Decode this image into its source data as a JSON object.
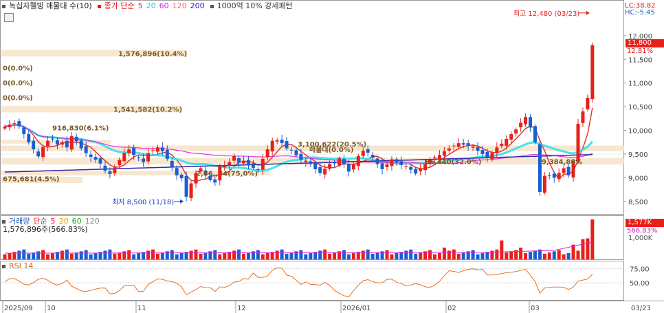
{
  "header": {
    "indicator_label": "녹십자웰빙 매물대 수(10)",
    "ma_label": "종가 단순",
    "ma_periods": [
      "5",
      "20",
      "60",
      "120",
      "200"
    ],
    "ma_colors": [
      "#e02020",
      "#20c8e0",
      "#e020e0",
      "#ff6060",
      "#2020c0"
    ],
    "extra_label": "1000억 10% 강세패턴"
  },
  "price_right": {
    "lc": "LC:38.82",
    "hc": "HC:-5.45",
    "current": "11,800",
    "current_pct": "12.81%"
  },
  "volume_header": {
    "label": "거래량",
    "ma_label": "단순",
    "periods": [
      "5",
      "20",
      "60",
      "120"
    ],
    "period_colors": [
      "#e0a000",
      "#e0a000",
      "#20a020",
      "#888888"
    ],
    "summary": "1,576,896주(566.83%)"
  },
  "volume_right": {
    "value": "1,577K",
    "pct": "566.83%",
    "tick": "1,000K"
  },
  "rsi_header": {
    "label": "RSI 14"
  },
  "chart_data": {
    "type": "candlestick",
    "y_ticks": [
      "12,000",
      "11,500",
      "11,000",
      "10,500",
      "10,000",
      "9,500",
      "9,000",
      "8,500"
    ],
    "y_tick_values": [
      12000,
      11500,
      11000,
      10500,
      10000,
      9500,
      9000,
      8500
    ],
    "ylim": [
      8250,
      12550
    ],
    "x_ticks": [
      "2025/09",
      "10",
      "11",
      "12",
      "2026/01",
      "02",
      "03",
      "03/23"
    ],
    "high_annotation": "최고 12,480 (03/23)",
    "low_annotation": "최저 8,500 (11/18)",
    "volume_profile_labels": [
      "1,576,896(10.4%)",
      "0(0.0%)",
      "0(0.0%)",
      "0(0.0%)",
      "1,541,582(10.2%)",
      "916,830(6.1%)",
      "675,681(4.5%)",
      "2,86.,34(75,0%)",
      "3,100,622(20.5%)",
      "매물대(0.0%)",
      "65,440(32.0%)",
      "9,384,80%"
    ],
    "closes": [
      10080,
      10120,
      10150,
      10090,
      9920,
      9750,
      9600,
      9450,
      9650,
      9780,
      9820,
      9700,
      9750,
      9640,
      9880,
      9770,
      9620,
      9520,
      9440,
      9380,
      9300,
      9150,
      9080,
      9220,
      9380,
      9520,
      9600,
      9480,
      9420,
      9330,
      9520,
      9580,
      9640,
      9560,
      9400,
      9220,
      9050,
      8990,
      8600,
      8880,
      9100,
      9200,
      9050,
      8950,
      8900,
      9250,
      9260,
      9330,
      9460,
      9320,
      9360,
      9260,
      9210,
      9170,
      9400,
      9600,
      9780,
      9790,
      9730,
      9620,
      9580,
      9470,
      9380,
      9360,
      9290,
      9180,
      9100,
      9190,
      9290,
      9310,
      9410,
      9280,
      9130,
      9280,
      9460,
      9570,
      9530,
      9420,
      9290,
      9180,
      9280,
      9390,
      9320,
      9270,
      9240,
      9170,
      9090,
      9190,
      9290,
      9380,
      9430,
      9480,
      9560,
      9620,
      9680,
      9730,
      9700,
      9680,
      9660,
      9570,
      9500,
      9420,
      9520,
      9640,
      9720,
      9820,
      9920,
      10020,
      10160,
      10280,
      10060,
      9750,
      8700,
      9040,
      9040,
      9000,
      9100,
      9200,
      9050,
      9350,
      10140,
      10400,
      10690,
      11800
    ],
    "rsi_ticks": [
      "75.00",
      "50.00"
    ],
    "rsi_tick_values": [
      75,
      50
    ]
  }
}
